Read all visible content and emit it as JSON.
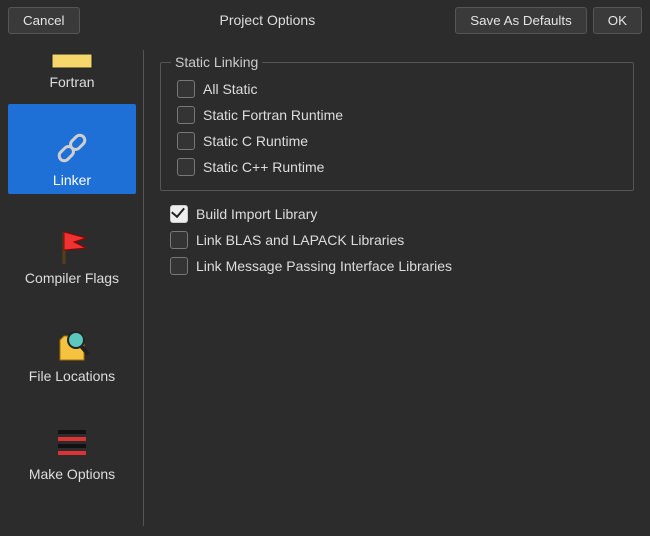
{
  "header": {
    "cancel": "Cancel",
    "title": "Project Options",
    "save_defaults": "Save As Defaults",
    "ok": "OK"
  },
  "sidebar": {
    "items": [
      {
        "id": "fortran",
        "label": "Fortran",
        "icon": "fortran-icon",
        "selected": false
      },
      {
        "id": "linker",
        "label": "Linker",
        "icon": "link-icon",
        "selected": true
      },
      {
        "id": "compiler-flags",
        "label": "Compiler Flags",
        "icon": "flag-icon",
        "selected": false
      },
      {
        "id": "file-locations",
        "label": "File Locations",
        "icon": "search-icon",
        "selected": false
      },
      {
        "id": "make-options",
        "label": "Make Options",
        "icon": "list-icon",
        "selected": false
      }
    ]
  },
  "main": {
    "group_title": "Static Linking",
    "static_options": [
      {
        "id": "all-static",
        "label": "All Static",
        "checked": false
      },
      {
        "id": "static-fortran-rt",
        "label": "Static Fortran Runtime",
        "checked": false
      },
      {
        "id": "static-c-rt",
        "label": "Static C Runtime",
        "checked": false
      },
      {
        "id": "static-cpp-rt",
        "label": "Static C++ Runtime",
        "checked": false
      }
    ],
    "other_options": [
      {
        "id": "build-import-lib",
        "label": "Build Import Library",
        "checked": true
      },
      {
        "id": "link-blas-lapack",
        "label": "Link BLAS and LAPACK Libraries",
        "checked": false
      },
      {
        "id": "link-mpi",
        "label": "Link Message Passing Interface Libraries",
        "checked": false
      }
    ]
  }
}
